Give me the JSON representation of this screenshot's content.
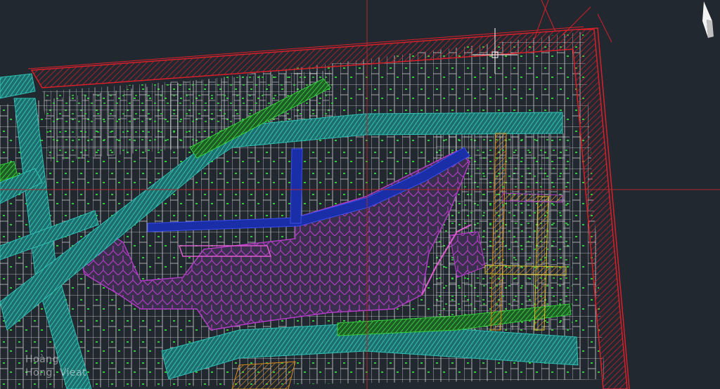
{
  "app": {
    "canvas": {
      "background_color": "#212830",
      "content": "cadastral site plan drawing"
    },
    "layer_colors": {
      "boundary_red": "#d8202a",
      "road_cyan": "#2fc0b4",
      "parcel_white": "#e8e8e8",
      "label_green": "#34d23c",
      "park_magenta": "#b13bc4",
      "canal_blue": "#1a2ea8",
      "path_orange": "#d98a1e",
      "road_yellow": "#d6c22a",
      "edge_pink": "#e05cd0"
    },
    "crosshair": {
      "color": "#b02a2a",
      "pickbox": true
    },
    "north_arrow": {
      "icon": "north-arrow-icon"
    },
    "watermark": {
      "line1": "Hoàng",
      "line2": "Hong. Vieat"
    }
  }
}
